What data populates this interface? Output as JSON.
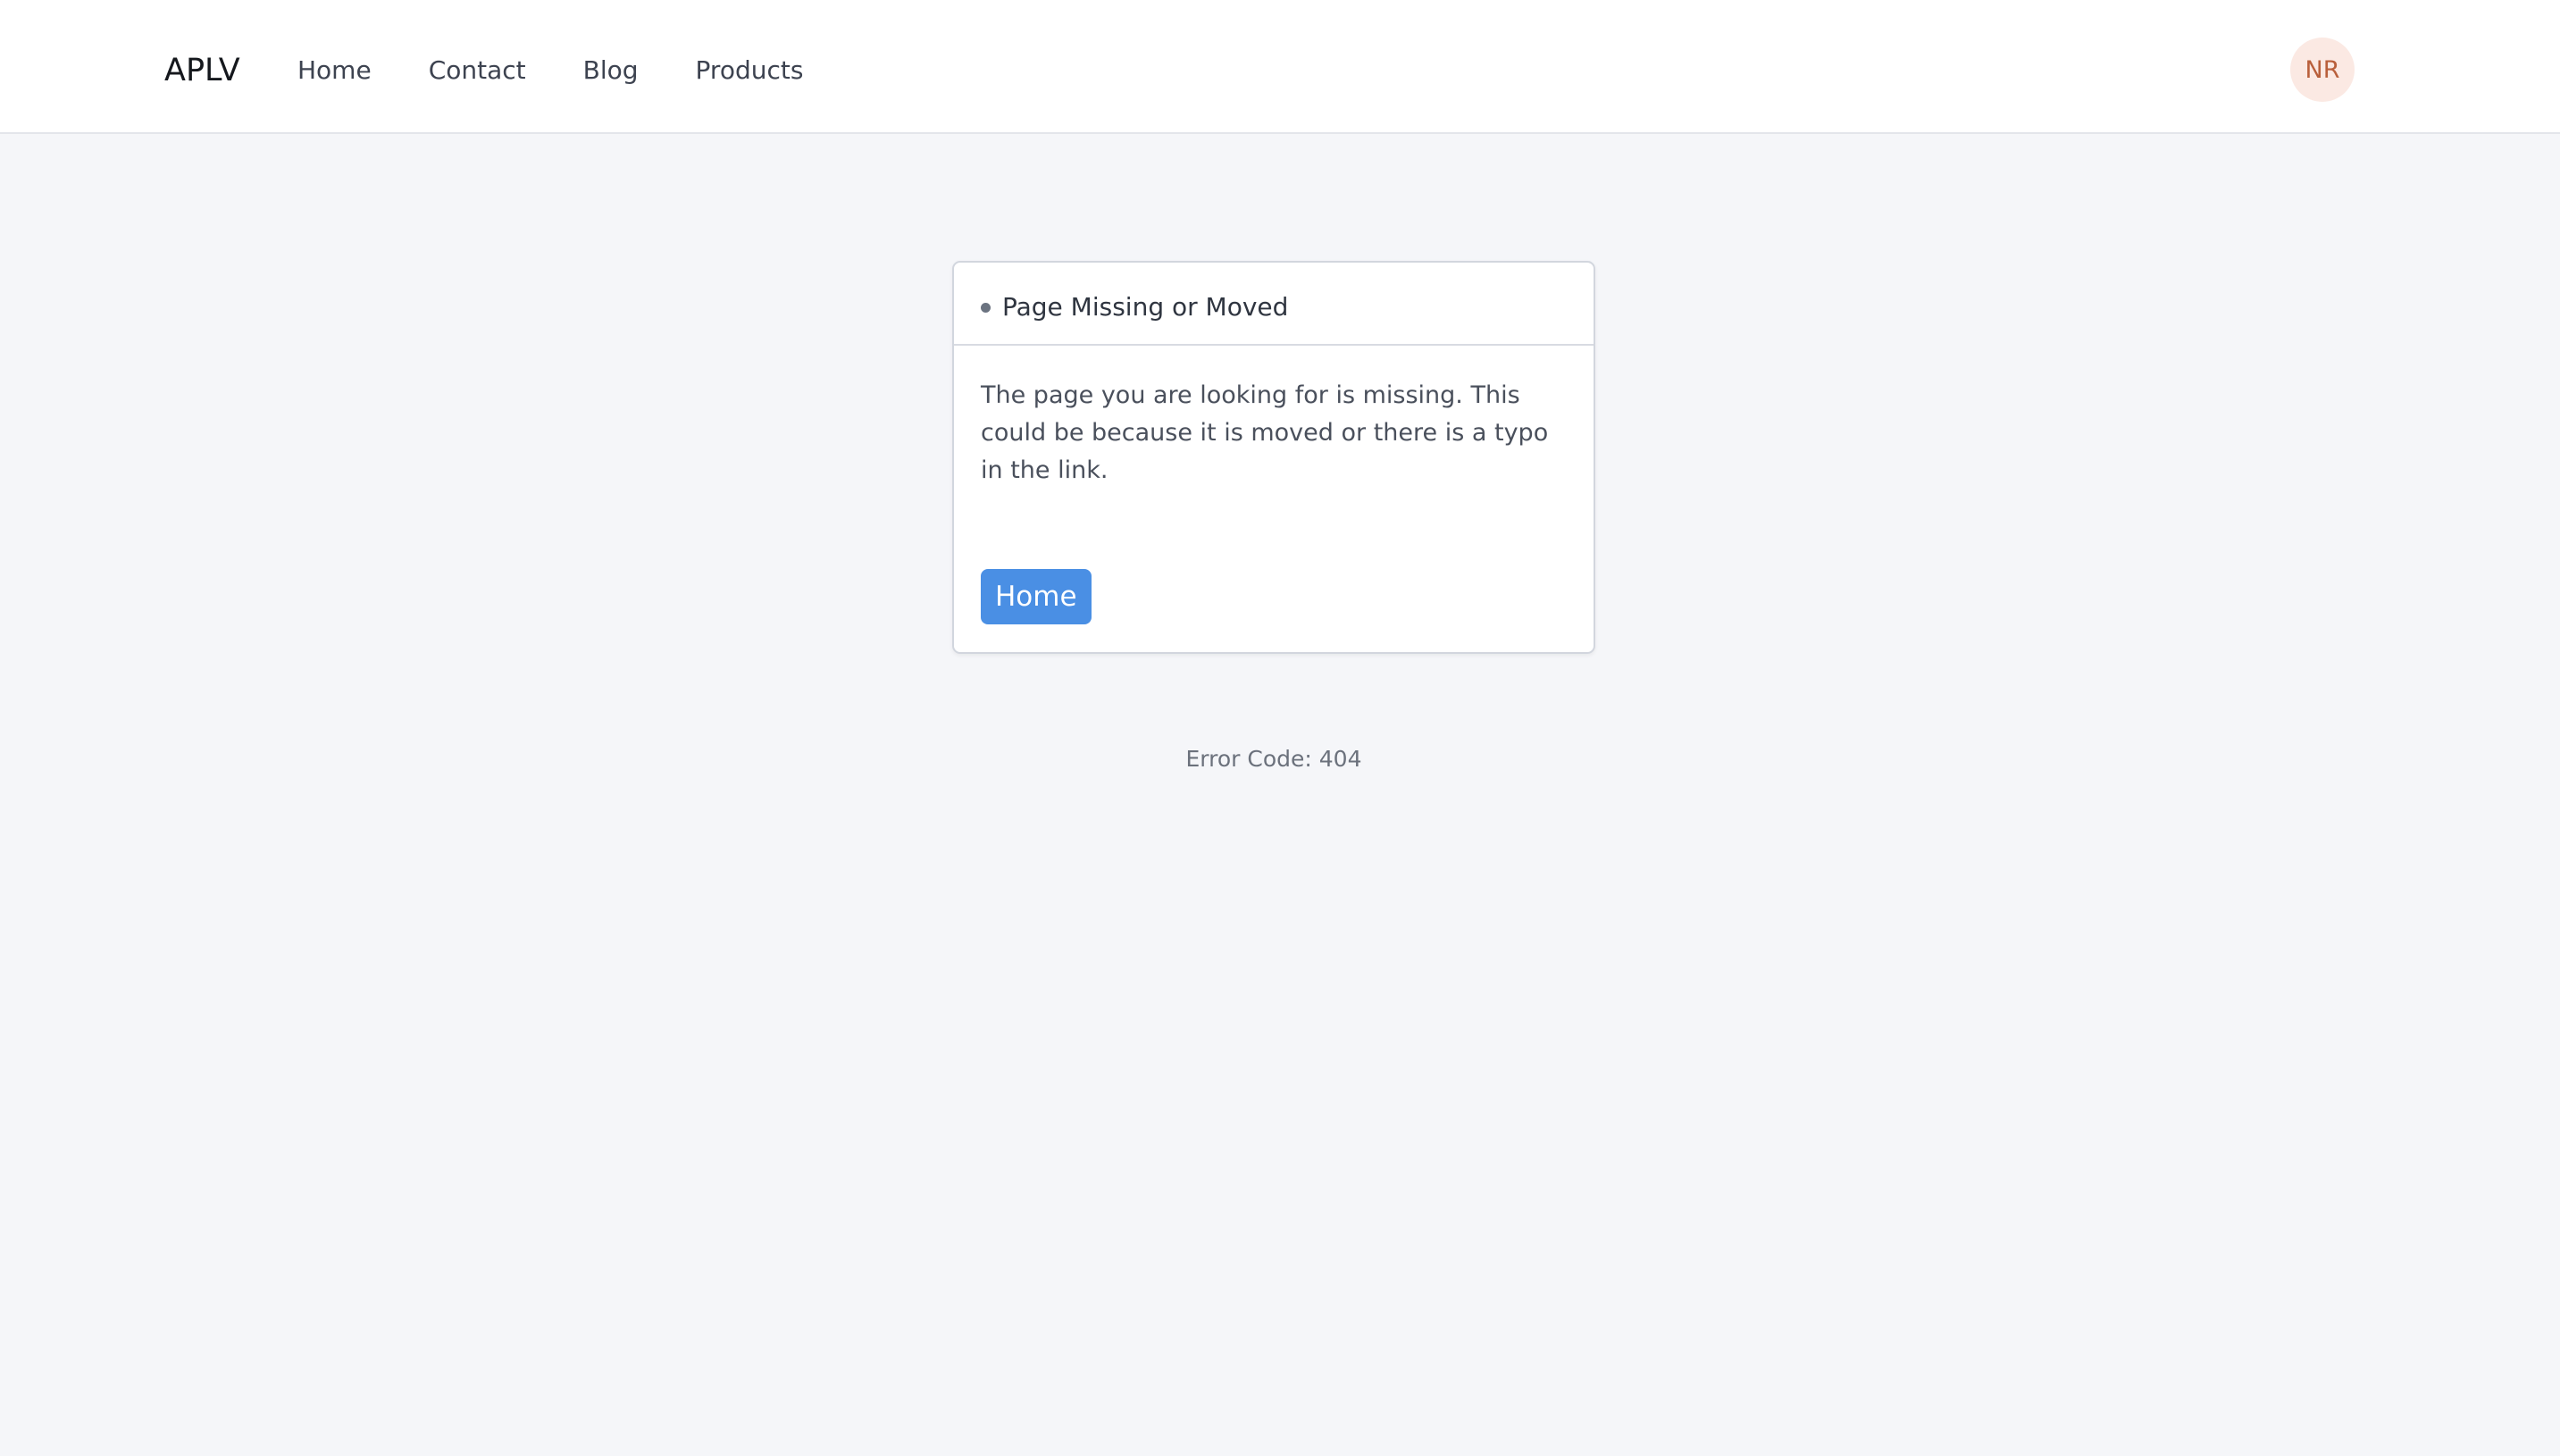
{
  "header": {
    "brand": "APLV",
    "nav": [
      {
        "label": "Home"
      },
      {
        "label": "Contact"
      },
      {
        "label": "Blog"
      },
      {
        "label": "Products"
      }
    ],
    "avatar_initials": "NR"
  },
  "card": {
    "title": "Page Missing or Moved",
    "message": "The page you are looking for is missing. This could be because it is moved or there is a typo in the link.",
    "button_label": "Home"
  },
  "error_code_text": "Error Code: 404",
  "colors": {
    "accent": "#4a8fe4",
    "background": "#f5f6f9",
    "avatar_bg": "#fbe9e3",
    "avatar_text": "#b95f3b"
  }
}
